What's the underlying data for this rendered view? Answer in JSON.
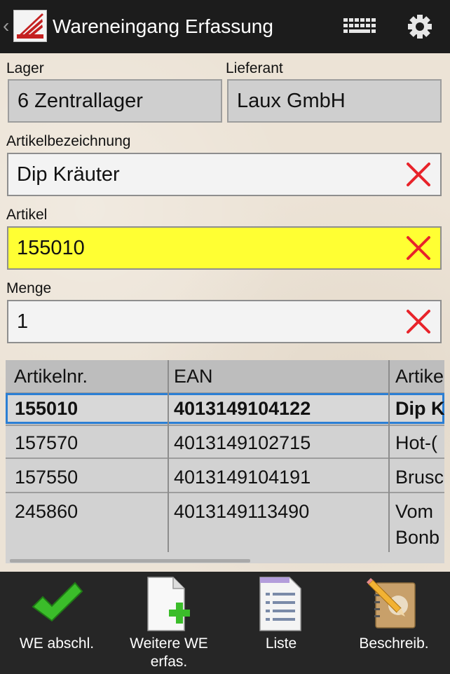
{
  "actionbar": {
    "title": "Wareneingang Erfassung",
    "icons": [
      "keyboard-icon",
      "gear-icon"
    ]
  },
  "form": {
    "lager_label": "Lager",
    "lager_value": "6 Zentrallager",
    "lieferant_label": "Lieferant",
    "lieferant_value": "Laux GmbH",
    "bezeichnung_label": "Artikelbezeichnung",
    "bezeichnung_value": "Dip Kräuter",
    "artikel_label": "Artikel",
    "artikel_value": "155010",
    "menge_label": "Menge",
    "menge_value": "1",
    "active_field_color": "#ffff33"
  },
  "table": {
    "headers": [
      "Artikelnr.",
      "EAN",
      "Artike"
    ],
    "rows": [
      {
        "artnr": "155010",
        "ean": "4013149104122",
        "bez": "Dip K"
      },
      {
        "artnr": "157570",
        "ean": "4013149102715",
        "bez": "Hot-("
      },
      {
        "artnr": "157550",
        "ean": "4013149104191",
        "bez": "Brusc"
      },
      {
        "artnr": "245860",
        "ean": "4013149113490",
        "bez": "Vom",
        "bez2": "Bonb"
      }
    ]
  },
  "toolbar": {
    "finish_label": "WE abschl.",
    "more_label": "Weitere WE erfas.",
    "list_label": "Liste",
    "describe_label": "Beschreib."
  }
}
